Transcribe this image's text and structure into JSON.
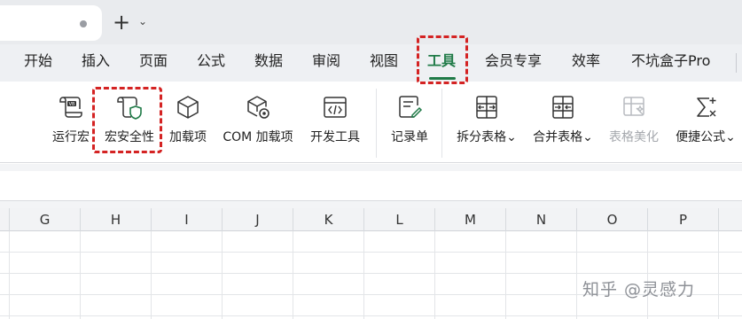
{
  "tabbar": {
    "new_tab_label": "+",
    "new_tab_menu": "⌄"
  },
  "menu": {
    "items": [
      "开始",
      "插入",
      "页面",
      "公式",
      "数据",
      "审阅",
      "视图",
      "工具",
      "会员专享",
      "效率",
      "不坑盒子Pro"
    ],
    "active": "工具",
    "accent_color": "#1f7a47"
  },
  "ribbon": {
    "tools": [
      {
        "label": "运行宏",
        "icon": "vb-macro-icon"
      },
      {
        "label": "宏安全性",
        "icon": "macro-security-icon"
      },
      {
        "label": "加载项",
        "icon": "addin-cube-icon"
      },
      {
        "label": "COM 加载项",
        "icon": "com-addin-icon"
      },
      {
        "label": "开发工具",
        "icon": "developer-tools-icon"
      },
      {
        "label": "记录单",
        "icon": "record-form-icon"
      },
      {
        "label": "拆分表格",
        "icon": "split-table-icon",
        "dropdown": true
      },
      {
        "label": "合并表格",
        "icon": "merge-table-icon",
        "dropdown": true
      },
      {
        "label": "表格美化",
        "icon": "table-beautify-icon",
        "disabled": true
      },
      {
        "label": "便捷公式",
        "icon": "quick-formula-icon",
        "dropdown": true
      }
    ],
    "dropdown_glyph": "⌄"
  },
  "highlight_color": "#d42323",
  "columns": [
    "G",
    "H",
    "I",
    "J",
    "K",
    "L",
    "M",
    "N",
    "O",
    "P"
  ],
  "watermark": "知乎 @灵感力"
}
